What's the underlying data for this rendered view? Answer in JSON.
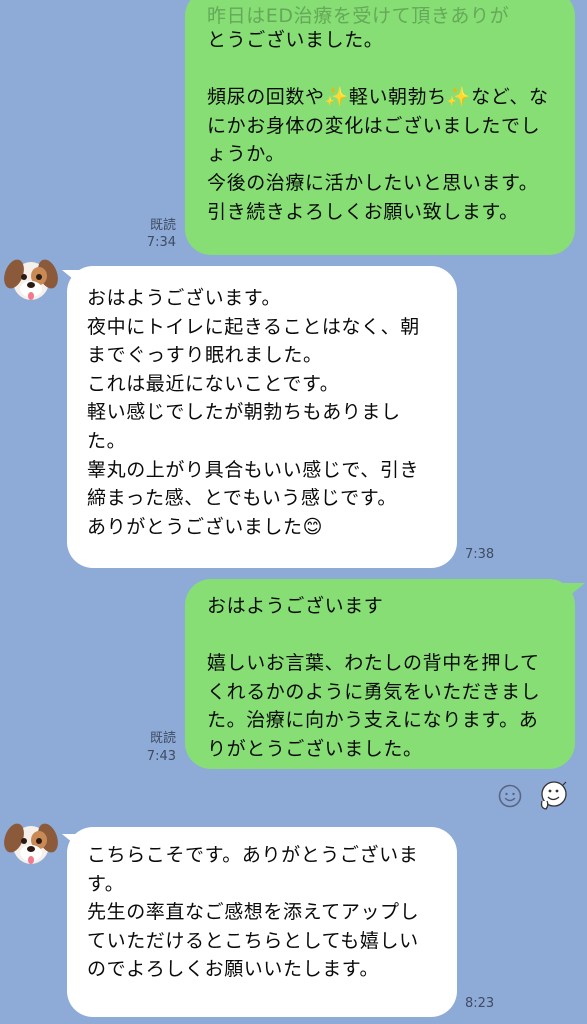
{
  "messages": [
    {
      "id": "m1",
      "direction": "out",
      "hidden_line": "昨日はED治療を受けて頂きありが",
      "text": "とうございました。\n\n頻尿の回数や✨軽い朝勃ち✨など、なにかお身体の変化はございましたでしょうか。\n今後の治療に活かしたいと思います。引き続きよろしくお願い致します。",
      "read": "既読",
      "time": "7:34"
    },
    {
      "id": "m2",
      "direction": "in",
      "text": "おはようございます。\n夜中にトイレに起きることはなく、朝までぐっすり眠れました。\nこれは最近にないことです。\n軽い感じでしたが朝勃ちもありました。\n睾丸の上がり具合もいい感じで、引き締まった感、とでもいう感じです。\nありがとうございました😊",
      "time": "7:38"
    },
    {
      "id": "m3",
      "direction": "out",
      "text": "おはようございます\n\n嬉しいお言葉、わたしの背中を押してくれるかのように勇気をいただきました。治療に向かう支えになります。ありがとうございました。",
      "read": "既読",
      "time": "7:43"
    },
    {
      "id": "m4",
      "direction": "in",
      "text": "こちらこそです。ありがとうございます。\n先生の率直なご感想を添えてアップしていただけるとこちらとしても嬉しいのでよろしくお願いいたします。",
      "time": "8:23"
    }
  ],
  "icons": {
    "avatar": "dog-face-icon",
    "reaction": "smiley-outline-icon",
    "sticker": "sticker-face-icon"
  },
  "colors": {
    "background": "#8eabd8",
    "outgoing_bubble": "#86de74",
    "incoming_bubble": "#ffffff",
    "meta_text": "#3f4c61"
  }
}
